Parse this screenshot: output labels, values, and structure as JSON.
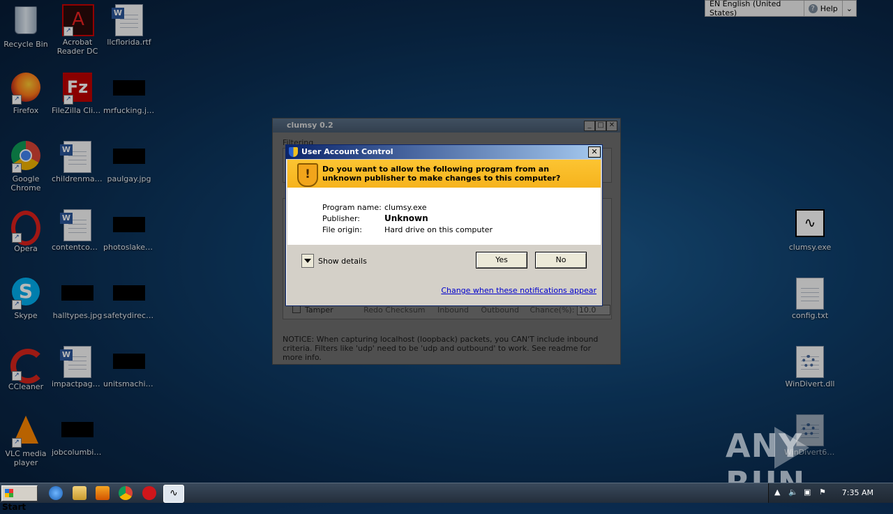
{
  "language_bar": {
    "language": "EN English (United States)",
    "help": "Help"
  },
  "desktop_icons": [
    {
      "label": "Recycle Bin"
    },
    {
      "label": "Acrobat Reader DC"
    },
    {
      "label": "llcflorida.rtf"
    },
    {
      "label": "Firefox"
    },
    {
      "label": "FileZilla Client"
    },
    {
      "label": "mrfucking.jpg"
    },
    {
      "label": "Google Chrome"
    },
    {
      "label": "childrenmail.rtf"
    },
    {
      "label": "paulgay.jpg"
    },
    {
      "label": "Opera"
    },
    {
      "label": "contentcom..."
    },
    {
      "label": "photoslake.jpg"
    },
    {
      "label": "Skype"
    },
    {
      "label": "halltypes.jpg"
    },
    {
      "label": "safetydirect..."
    },
    {
      "label": "CCleaner"
    },
    {
      "label": "impactpage.rtf"
    },
    {
      "label": "unitsmachin..."
    },
    {
      "label": "VLC media player"
    },
    {
      "label": "jobcolumbia..."
    },
    {
      "label": "clumsy.exe"
    },
    {
      "label": "config.txt"
    },
    {
      "label": "WinDivert.dll"
    },
    {
      "label": "WinDivert64..."
    }
  ],
  "clumsy": {
    "title": "clumsy 0.2",
    "filtering_label": "Filtering",
    "tamper": "Tamper",
    "tamper_options": [
      "Redo Checksum",
      "Inbound",
      "Outbound"
    ],
    "chance_label": "Chance(%):",
    "chance_value": "10.0",
    "notice": "NOTICE: When capturing localhost (loopback) packets, you CAN'T include inbound criteria. Filters like 'udp' need to be 'udp and outbound' to work. See readme for more info."
  },
  "uac": {
    "title": "User Account Control",
    "question": "Do you want to allow the following program from an unknown publisher to make changes to this computer?",
    "program_name_label": "Program name:",
    "program_name": "clumsy.exe",
    "publisher_label": "Publisher:",
    "publisher": "Unknown",
    "origin_label": "File origin:",
    "origin": "Hard drive on this computer",
    "show_details": "Show details",
    "yes": "Yes",
    "no": "No",
    "change_link": "Change when these notifications appear"
  },
  "taskbar": {
    "start": "Start",
    "time": "7:35 AM"
  },
  "watermark": "ANY RUN"
}
